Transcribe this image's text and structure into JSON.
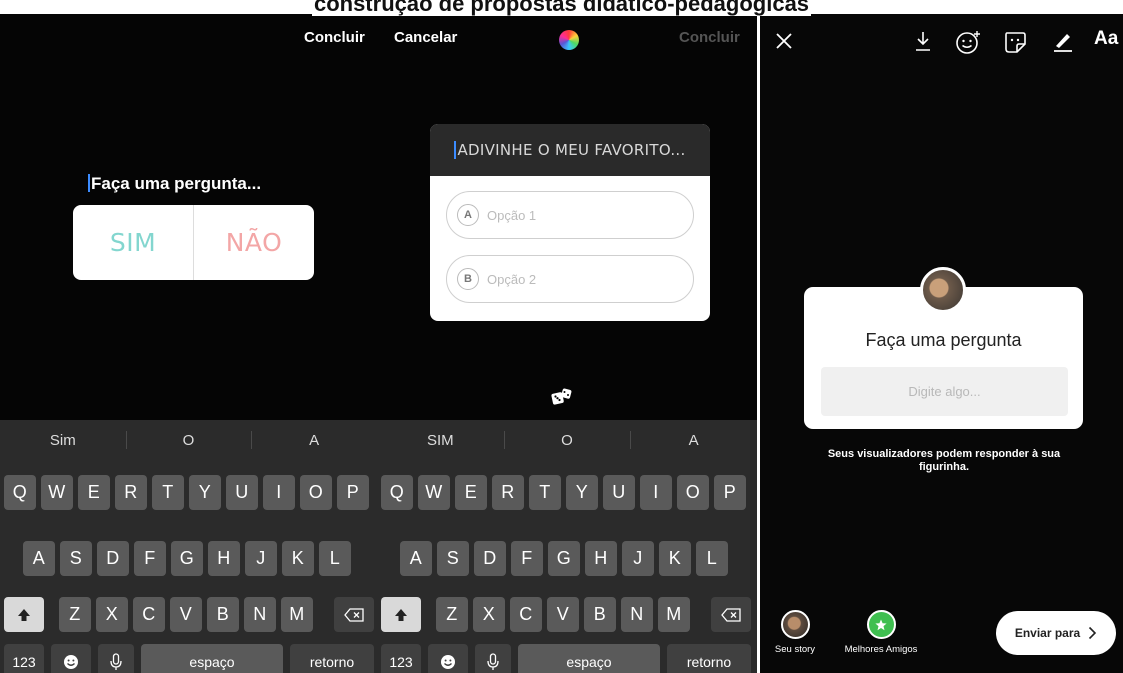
{
  "header": {
    "title": "construção de propostas didático-pedagógicas"
  },
  "panel1": {
    "done_label": "Concluir",
    "question": "Faça uma pergunta...",
    "options": [
      "SIM",
      "NÃO"
    ],
    "colors": {
      "sim": "#83d6cf",
      "nao": "#f3a6a6"
    }
  },
  "panel2": {
    "cancel_label": "Cancelar",
    "done_label": "Concluir",
    "color_picker_icon": "color-wheel-icon",
    "quiz_question": "ADIVINHE O MEU FAVORITO...",
    "quiz_options": [
      {
        "letter": "A",
        "text": "Opção 1"
      },
      {
        "letter": "B",
        "text": "Opção 2"
      }
    ],
    "dice_icon": "dice-icon"
  },
  "keyboard1": {
    "suggestions": [
      "Sim",
      "O",
      "A"
    ],
    "row1": [
      "Q",
      "W",
      "E",
      "R",
      "T",
      "Y",
      "U",
      "I",
      "O",
      "P"
    ],
    "row2": [
      "A",
      "S",
      "D",
      "F",
      "G",
      "H",
      "J",
      "K",
      "L"
    ],
    "row3": [
      "Z",
      "X",
      "C",
      "V",
      "B",
      "N",
      "M"
    ],
    "numbers_label": "123",
    "space_label": "espaço",
    "return_label": "retorno"
  },
  "keyboard2": {
    "suggestions": [
      "SIM",
      "O",
      "A"
    ],
    "row1": [
      "Q",
      "W",
      "E",
      "R",
      "T",
      "Y",
      "U",
      "I",
      "O",
      "P"
    ],
    "row2": [
      "A",
      "S",
      "D",
      "F",
      "G",
      "H",
      "J",
      "K",
      "L"
    ],
    "row3": [
      "Z",
      "X",
      "C",
      "V",
      "B",
      "N",
      "M"
    ],
    "numbers_label": "123",
    "space_label": "espaço",
    "return_label": "retorno"
  },
  "panel3": {
    "toolbar_icons": [
      "close-icon",
      "download-icon",
      "face-effects-icon",
      "sticker-icon",
      "draw-icon"
    ],
    "text_tool_label": "Aa",
    "question_title": "Faça uma pergunta",
    "input_placeholder": "Digite algo...",
    "note": "Seus visualizadores podem responder à sua figurinha.",
    "your_story_label": "Seu story",
    "close_friends_label": "Melhores Amigos",
    "send_label": "Enviar para",
    "close_friends_color": "#3fbf50"
  }
}
